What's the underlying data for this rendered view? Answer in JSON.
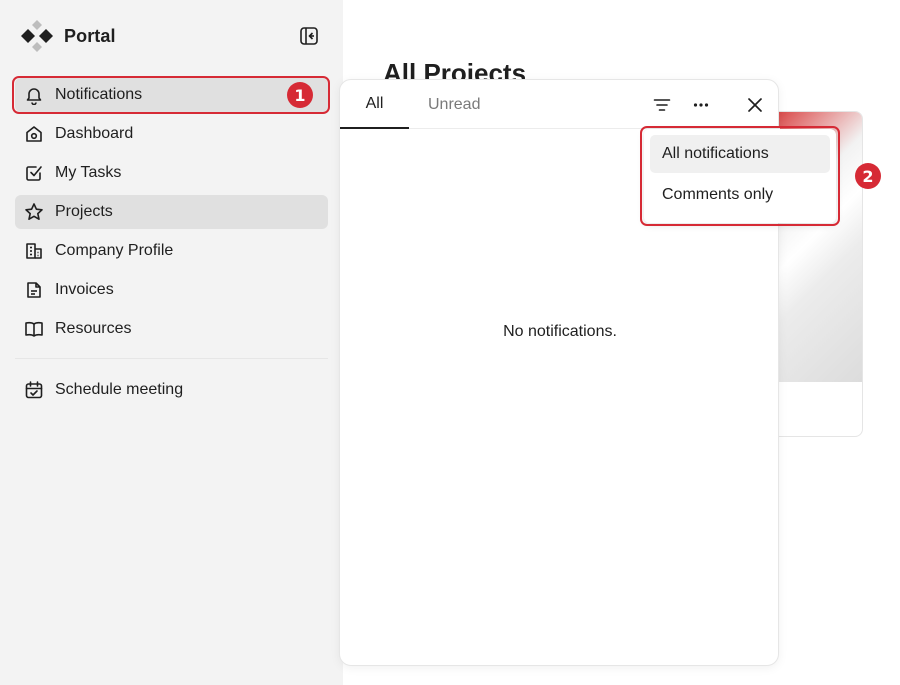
{
  "brand": {
    "name": "Portal"
  },
  "sidebar": {
    "items": [
      {
        "label": "Notifications",
        "icon": "bell-icon"
      },
      {
        "label": "Dashboard",
        "icon": "home-icon"
      },
      {
        "label": "My Tasks",
        "icon": "checkbox-icon"
      },
      {
        "label": "Projects",
        "icon": "star-icon"
      },
      {
        "label": "Company Profile",
        "icon": "building-icon"
      },
      {
        "label": "Invoices",
        "icon": "document-icon"
      },
      {
        "label": "Resources",
        "icon": "book-icon"
      }
    ],
    "secondary": [
      {
        "label": "Schedule meeting",
        "icon": "calendar-icon"
      }
    ],
    "active": "Projects"
  },
  "main": {
    "title": "All Projects"
  },
  "notifications": {
    "tabs": [
      {
        "label": "All",
        "selected": true
      },
      {
        "label": "Unread",
        "selected": false
      }
    ],
    "empty_text": "No notifications.",
    "filter_menu": {
      "items": [
        {
          "label": "All notifications",
          "selected": true
        },
        {
          "label": "Comments only",
          "selected": false
        }
      ]
    }
  },
  "annotations": [
    {
      "number": "1"
    },
    {
      "number": "2"
    }
  ],
  "colors": {
    "highlight": "#d62a35",
    "sidebar_bg": "#f3f3f3",
    "active_bg": "#e0e0e0"
  }
}
